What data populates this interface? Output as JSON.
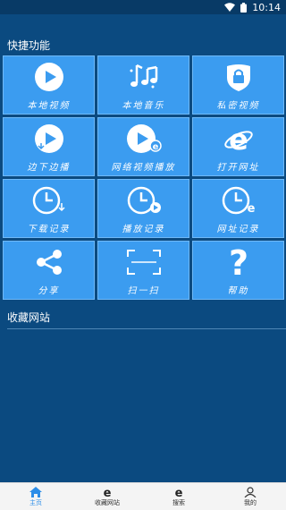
{
  "status": {
    "time": "10:14"
  },
  "sections": {
    "quick": "快捷功能",
    "favorites": "收藏网站"
  },
  "tiles": [
    {
      "label": "本地视频",
      "icon": "play-circle-icon"
    },
    {
      "label": "本地音乐",
      "icon": "music-notes-icon"
    },
    {
      "label": "私密视频",
      "icon": "lock-shield-icon"
    },
    {
      "label": "边下边播",
      "icon": "play-download-icon"
    },
    {
      "label": "网络视频播放",
      "icon": "play-ie-icon"
    },
    {
      "label": "打开网址",
      "icon": "ie-icon"
    },
    {
      "label": "下载记录",
      "icon": "clock-download-icon"
    },
    {
      "label": "播放记录",
      "icon": "clock-play-icon"
    },
    {
      "label": "网址记录",
      "icon": "clock-ie-icon"
    },
    {
      "label": "分享",
      "icon": "share-icon"
    },
    {
      "label": "扫一扫",
      "icon": "scan-icon"
    },
    {
      "label": "帮助",
      "icon": "help-icon"
    }
  ],
  "nav": [
    {
      "label": "主页",
      "icon": "home-icon",
      "active": true
    },
    {
      "label": "收藏网站",
      "icon": "ie-icon"
    },
    {
      "label": "搜索",
      "icon": "ie-icon"
    },
    {
      "label": "我的",
      "icon": "user-icon"
    }
  ],
  "colors": {
    "background": "#0b4a80",
    "tile": "#3b9cf0",
    "accent": "#2d8ee8"
  }
}
